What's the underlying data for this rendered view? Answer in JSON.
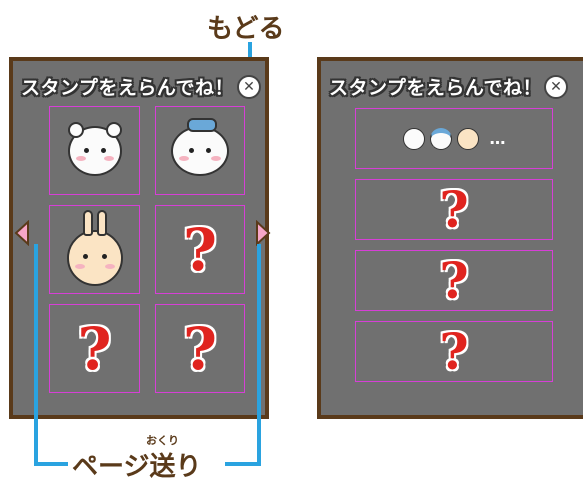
{
  "labels": {
    "back": "もどる",
    "page_turn": "ページ送り",
    "page_turn_ruby": "おくり"
  },
  "panel_left": {
    "title": "スタンプをえらんでね！",
    "close_glyph": "✕",
    "cells": [
      {
        "kind": "sticker",
        "sticker": "white-bear"
      },
      {
        "kind": "sticker",
        "sticker": "blue-bow-bear"
      },
      {
        "kind": "sticker",
        "sticker": "rabbit"
      },
      {
        "kind": "locked",
        "text": "?"
      },
      {
        "kind": "locked",
        "text": "?"
      },
      {
        "kind": "locked",
        "text": "?"
      }
    ]
  },
  "panel_right": {
    "title": "スタンプをえらんでね！",
    "close_glyph": "✕",
    "row1_ellipsis": "…",
    "rows": [
      {
        "kind": "locked",
        "text": "?"
      },
      {
        "kind": "locked",
        "text": "?"
      },
      {
        "kind": "locked",
        "text": "?"
      }
    ]
  },
  "colors": {
    "panel_bg": "#707070",
    "panel_border": "#5a3a1a",
    "cell_border": "#d63fd6",
    "question": "#e0241f",
    "callout": "#2aa3e0",
    "arrow": "#f7a6c8"
  },
  "icons": {
    "close": "close-icon",
    "prev": "chevron-left-icon",
    "next": "chevron-right-icon"
  }
}
